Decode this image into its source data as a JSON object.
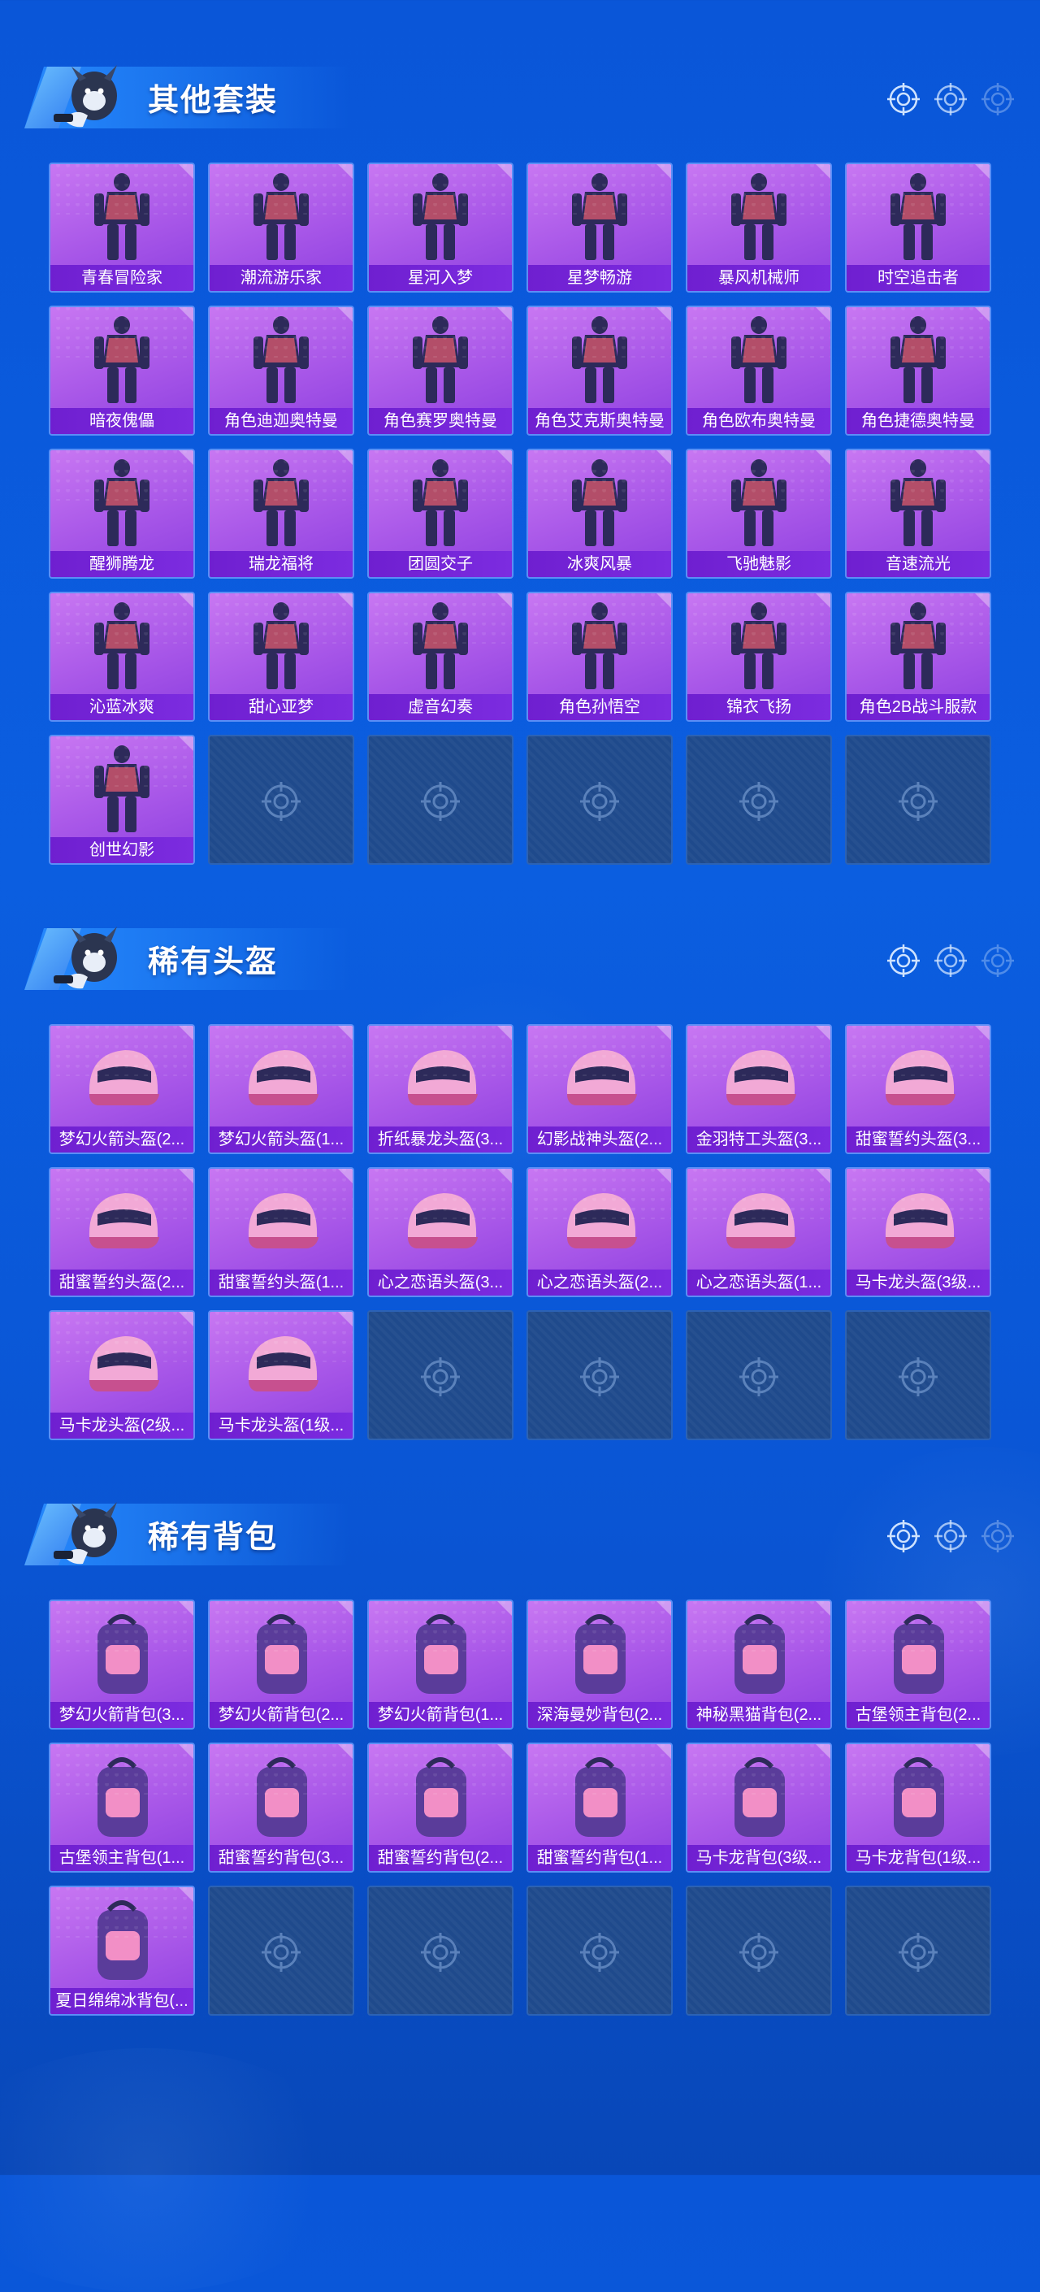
{
  "sections": [
    {
      "title": "其他套装",
      "items": [
        "青春冒险家",
        "潮流游乐家",
        "星河入梦",
        "星梦畅游",
        "暴风机械师",
        "时空追击者",
        "暗夜傀儡",
        "角色迪迦奥特曼",
        "角色赛罗奥特曼",
        "角色艾克斯奥特曼",
        "角色欧布奥特曼",
        "角色捷德奥特曼",
        "醒狮腾龙",
        "瑞龙福将",
        "团圆交子",
        "冰爽风暴",
        "飞驰魅影",
        "音速流光",
        "沁蓝冰爽",
        "甜心亚梦",
        "虚音幻奏",
        "角色孙悟空",
        "锦衣飞扬",
        "角色2B战斗服款",
        "创世幻影"
      ],
      "empty_slots": 5
    },
    {
      "title": "稀有头盔",
      "items": [
        "梦幻火箭头盔(2...",
        "梦幻火箭头盔(1...",
        "折纸暴龙头盔(3...",
        "幻影战神头盔(2...",
        "金羽特工头盔(3...",
        "甜蜜誓约头盔(3...",
        "甜蜜誓约头盔(2...",
        "甜蜜誓约头盔(1...",
        "心之恋语头盔(3...",
        "心之恋语头盔(2...",
        "心之恋语头盔(1...",
        "马卡龙头盔(3级...",
        "马卡龙头盔(2级...",
        "马卡龙头盔(1级..."
      ],
      "empty_slots": 4
    },
    {
      "title": "稀有背包",
      "items": [
        "梦幻火箭背包(3...",
        "梦幻火箭背包(2...",
        "梦幻火箭背包(1...",
        "深海曼妙背包(2...",
        "神秘黑猫背包(2...",
        "古堡领主背包(2...",
        "古堡领主背包(1...",
        "甜蜜誓约背包(3...",
        "甜蜜誓约背包(2...",
        "甜蜜誓约背包(1...",
        "马卡龙背包(3级...",
        "马卡龙背包(1级...",
        "夏日绵绵冰背包(..."
      ],
      "empty_slots": 5
    }
  ],
  "icons": {
    "mascot": "mascot-icon",
    "decor": "crosshair-icon",
    "empty": "crosshair-icon"
  },
  "colors": {
    "background": "#0a56d8",
    "card_purple": "#a857e8",
    "label_purple": "#7c2ce0",
    "empty_slot": "#1f4a8c"
  }
}
